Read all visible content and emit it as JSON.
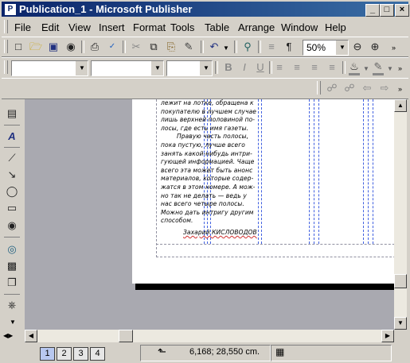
{
  "window": {
    "app_icon": "publisher-icon",
    "title": "Publication_1 - Microsoft Publisher",
    "minimize": "_",
    "maximize": "□",
    "close": "×"
  },
  "menu": [
    "File",
    "Edit",
    "View",
    "Insert",
    "Format",
    "Tools",
    "Table",
    "Arrange",
    "Window",
    "Help"
  ],
  "standard_toolbar": {
    "zoom": "50%",
    "icons": [
      "new-icon",
      "open-icon",
      "save-icon",
      "print-preview-icon",
      "print-icon",
      "spelling-icon",
      "cut-icon",
      "copy-icon",
      "paste-icon",
      "format-painter-icon",
      "undo-icon",
      "insert-picture-icon",
      "columns-icon",
      "show-marks-icon",
      "zoom-out-icon",
      "zoom-in-icon"
    ]
  },
  "formatting_toolbar": {
    "style_value": "",
    "font_value": "",
    "size_value": "",
    "icons": [
      "bold-icon",
      "italic-icon",
      "underline-icon",
      "align-left-icon",
      "align-center-icon",
      "align-right-icon",
      "justify-icon",
      "fill-color-icon",
      "line-color-icon"
    ]
  },
  "connect_toolbar": {
    "icons": [
      "create-link-icon",
      "break-link-icon",
      "previous-frame-icon",
      "next-frame-icon"
    ]
  },
  "objects_toolbar": {
    "icons": [
      "pointer-icon",
      "text-box-icon",
      "wordart-icon",
      "line-icon",
      "arrow-icon",
      "oval-icon",
      "rectangle-icon",
      "autoshapes-icon",
      "hot-spot-icon",
      "form-control-icon",
      "design-gallery-icon",
      "add-object-icon"
    ]
  },
  "page_text": {
    "lines": [
      "лежит на лотке, обращена к",
      "покупателю в лучшем случае",
      "лишь верхней половиной по-",
      "лосы, где есть имя газеты.",
      "Правую часть полосы,",
      "пока пустую, лучше всего",
      "занять какой-нибудь интри-",
      "гующей информацией. Чаще",
      "всего эта может быть анонс",
      "материалов, которые содер-",
      "жатся в этом номере. А мож-",
      "но так не делать — ведь у",
      "нас всего четыре полосы.",
      "Можно дать интригу другим",
      "способом."
    ],
    "signature": "Захарий КИСЛОВОДОВ"
  },
  "status": {
    "pages": [
      "1",
      "2",
      "3",
      "4"
    ],
    "active_page": "1",
    "position": "6,168; 28,550 cm."
  },
  "colors": {
    "titlebar_start": "#0a246a",
    "titlebar_end": "#3a6ea5",
    "workspace": "#a9a9b0",
    "guides": "#4060e0"
  }
}
